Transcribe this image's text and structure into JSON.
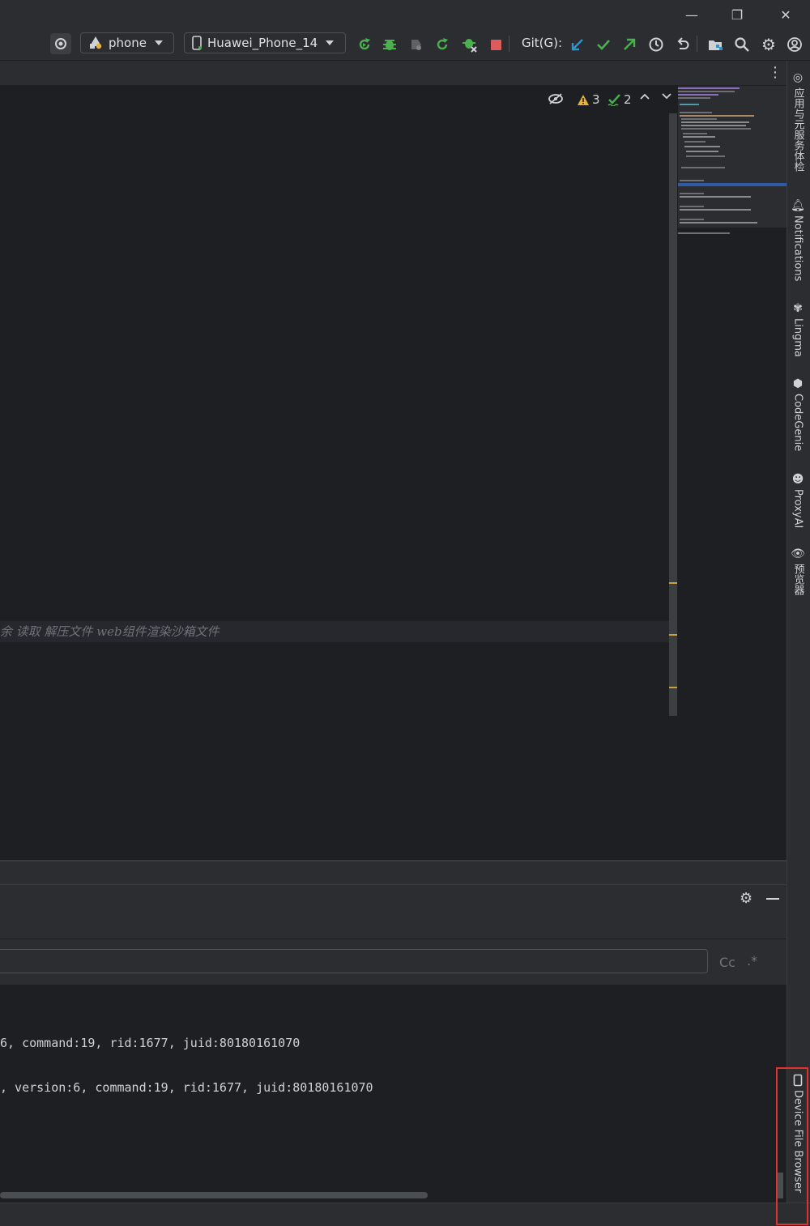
{
  "window": {
    "minimize_glyph": "—",
    "restore_glyph": "❐",
    "close_glyph": "✕"
  },
  "toolbar": {
    "module_label": "phone",
    "device_label": "Huawei_Phone_14",
    "git_label": "Git(G):",
    "icons": [
      "target-icon",
      "run-icon",
      "debug-icon",
      "profile-icon",
      "apply-changes-icon",
      "attach-debugger-icon",
      "stop-icon",
      "git-update-icon",
      "git-commit-icon",
      "git-push-icon",
      "history-icon",
      "rollback-icon",
      "project-structure-icon",
      "search-icon",
      "settings-icon",
      "account-icon"
    ],
    "colors": {
      "run": "#4caf50",
      "stop": "#db5c5c",
      "update": "#3592c4",
      "push": "#4caf50"
    }
  },
  "tabstrip": {
    "more_glyph": "⋮"
  },
  "editor": {
    "inspection": {
      "warnings": "3",
      "typos": "2"
    },
    "comment_text": "余 读取 解压文件 web组件渲染沙箱文件"
  },
  "right_tools": [
    {
      "label": "应用与元服务体检",
      "icon": "app-health-icon"
    },
    {
      "label": "Notifications",
      "icon": "bell-icon"
    },
    {
      "label": "Lingma",
      "icon": "lingma-icon"
    },
    {
      "label": "CodeGenie",
      "icon": "codegenie-icon"
    },
    {
      "label": "ProxyAI",
      "icon": "proxyai-icon"
    },
    {
      "label": "预览器",
      "icon": "eye-icon"
    },
    {
      "label": "Device File Browser",
      "icon": "device-icon"
    }
  ],
  "bottom": {
    "match_case": "Cc",
    "regex": ".*",
    "log_lines": [
      "6, command:19, rid:1677, juid:80180161070",
      ", version:6, command:19, rid:1677, juid:80180161070"
    ]
  }
}
